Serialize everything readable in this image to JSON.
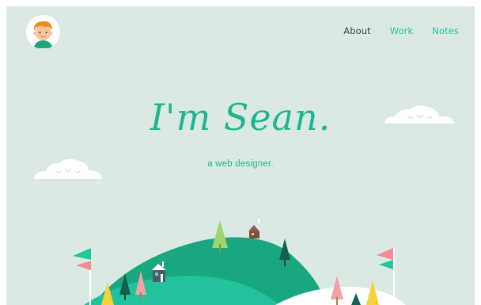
{
  "nav": {
    "items": [
      {
        "label": "About"
      },
      {
        "label": "Work"
      },
      {
        "label": "Notes"
      }
    ]
  },
  "hero": {
    "title": "I'm Sean.",
    "subtitle": "a web designer."
  },
  "colors": {
    "background": "#dbe9e3",
    "accent": "#1fb590",
    "nav_active": "#2a4a44",
    "nav_link": "#1fc3a0",
    "cloud": "#ffffff",
    "hill_dark": "#19a77f",
    "hill_light": "#22c39c",
    "flag_green": "#1fc79a",
    "flag_pink": "#f28e92"
  },
  "icons": {
    "avatar": "avatar-boy-face",
    "cloud": "smiling-cloud-icon",
    "tree": "tree-icon",
    "house": "house-icon",
    "flag": "flag-icon"
  }
}
